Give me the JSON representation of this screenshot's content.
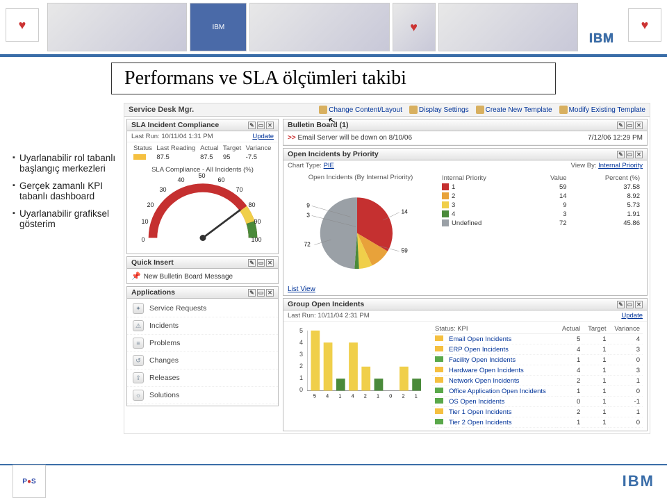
{
  "slide": {
    "title": "Performans ve SLA ölçümleri takibi",
    "bullets": [
      "Uyarlanabilir rol tabanlı başlangıç merkezleri",
      "Gerçek zamanlı KPI tabanlı dashboard",
      "Uyarlanabilir grafiksel gösterim"
    ]
  },
  "dashboard": {
    "header": "Service Desk Mgr.",
    "toolbar": [
      "Change Content/Layout",
      "Display Settings",
      "Create New Template",
      "Modify Existing Template"
    ],
    "sla_panel": {
      "title": "SLA Incident Compliance",
      "last_run_label": "Last Run:",
      "last_run": "10/11/04 1:31 PM",
      "update": "Update",
      "cols": [
        "Status",
        "Last Reading",
        "Actual",
        "Target",
        "Variance"
      ],
      "row": {
        "last": "87.5",
        "actual": "87.5",
        "target": "95",
        "variance": "-7.5"
      },
      "gauge_title": "SLA Compliance - All Incidents (%)"
    },
    "bulletin": {
      "title": "Bulletin Board (1)",
      "msg_prefix": ">>",
      "msg": "Email Server will be down on 8/10/06",
      "time": "7/12/06 12:29 PM"
    },
    "pie_panel": {
      "title": "Open Incidents by Priority",
      "chart_type_label": "Chart Type:",
      "chart_type": "PIE",
      "view_by_label": "View By:",
      "view_by": "Internal Priority",
      "chart_title": "Open Incidents (By Internal Priority)",
      "table_head": [
        "Internal Priority",
        "Value",
        "Percent (%)"
      ],
      "rows": [
        {
          "color": "#c53030",
          "label": "1",
          "value": "59",
          "pct": "37.58"
        },
        {
          "color": "#e8a23a",
          "label": "2",
          "value": "14",
          "pct": "8.92"
        },
        {
          "color": "#f0cf4a",
          "label": "3",
          "value": "9",
          "pct": "5.73"
        },
        {
          "color": "#4a8a3a",
          "label": "4",
          "value": "3",
          "pct": "1.91"
        },
        {
          "color": "#9aa0a6",
          "label": "Undefined",
          "value": "72",
          "pct": "45.86"
        }
      ]
    },
    "quick_insert": {
      "title": "Quick Insert",
      "item": "New Bulletin Board Message"
    },
    "list_view": "List View",
    "apps": {
      "title": "Applications",
      "items": [
        "Service Requests",
        "Incidents",
        "Problems",
        "Changes",
        "Releases",
        "Solutions"
      ]
    },
    "group_panel": {
      "title": "Group Open Incidents",
      "last_run_label": "Last Run:",
      "last_run": "10/11/04 2:31 PM",
      "update": "Update",
      "status_label": "Status: KPI",
      "cols": [
        "Actual",
        "Target",
        "Variance"
      ],
      "rows": [
        {
          "c": "#f5c040",
          "name": "Email Open Incidents",
          "a": "5",
          "t": "1",
          "v": "4"
        },
        {
          "c": "#f5c040",
          "name": "ERP Open Incidents",
          "a": "4",
          "t": "1",
          "v": "3"
        },
        {
          "c": "#5aa84a",
          "name": "Facility Open Incidents",
          "a": "1",
          "t": "1",
          "v": "0"
        },
        {
          "c": "#f5c040",
          "name": "Hardware Open Incidents",
          "a": "4",
          "t": "1",
          "v": "3"
        },
        {
          "c": "#f5c040",
          "name": "Network Open Incidents",
          "a": "2",
          "t": "1",
          "v": "1"
        },
        {
          "c": "#5aa84a",
          "name": "Office Application Open Incidents",
          "a": "1",
          "t": "1",
          "v": "0"
        },
        {
          "c": "#5aa84a",
          "name": "OS Open Incidents",
          "a": "0",
          "t": "1",
          "v": "-1"
        },
        {
          "c": "#f5c040",
          "name": "Tier 1 Open Incidents",
          "a": "2",
          "t": "1",
          "v": "1"
        },
        {
          "c": "#5aa84a",
          "name": "Tier 2 Open Incidents",
          "a": "1",
          "t": "1",
          "v": "0"
        }
      ]
    }
  },
  "chart_data": [
    {
      "type": "gauge",
      "title": "SLA Compliance - All Incidents (%)",
      "min": 0,
      "max": 100,
      "ticks": [
        0,
        10,
        20,
        30,
        40,
        50,
        60,
        70,
        80,
        90,
        100
      ],
      "zones": [
        {
          "from": 0,
          "to": 80,
          "color": "#c53030"
        },
        {
          "from": 80,
          "to": 90,
          "color": "#f0cf4a"
        },
        {
          "from": 90,
          "to": 100,
          "color": "#4a8a3a"
        }
      ],
      "value": 87.5
    },
    {
      "type": "pie",
      "title": "Open Incidents (By Internal Priority)",
      "categories": [
        "1",
        "2",
        "3",
        "4",
        "Undefined"
      ],
      "values": [
        59,
        14,
        9,
        3,
        72
      ],
      "colors": [
        "#c53030",
        "#e8a23a",
        "#f0cf4a",
        "#4a8a3a",
        "#9aa0a6"
      ]
    },
    {
      "type": "bar",
      "title": "Group Open Incidents",
      "categories": [
        "Email",
        "ERP",
        "Facility",
        "Hardware",
        "Network",
        "Office App",
        "OS",
        "Tier 1",
        "Tier 2"
      ],
      "x_tick_values": [
        5,
        4,
        1,
        4,
        2,
        1,
        0,
        2,
        1
      ],
      "values": [
        5,
        4,
        1,
        4,
        2,
        1,
        0,
        2,
        1
      ],
      "colors": [
        "#f0cf4a",
        "#f0cf4a",
        "#4a8a3a",
        "#f0cf4a",
        "#f0cf4a",
        "#4a8a3a",
        "#4a8a3a",
        "#f0cf4a",
        "#4a8a3a"
      ],
      "ylim": [
        0,
        5
      ],
      "ylabel": "",
      "xlabel": ""
    }
  ],
  "logos": {
    "pos": "P  S",
    "ibm": "IBM"
  }
}
